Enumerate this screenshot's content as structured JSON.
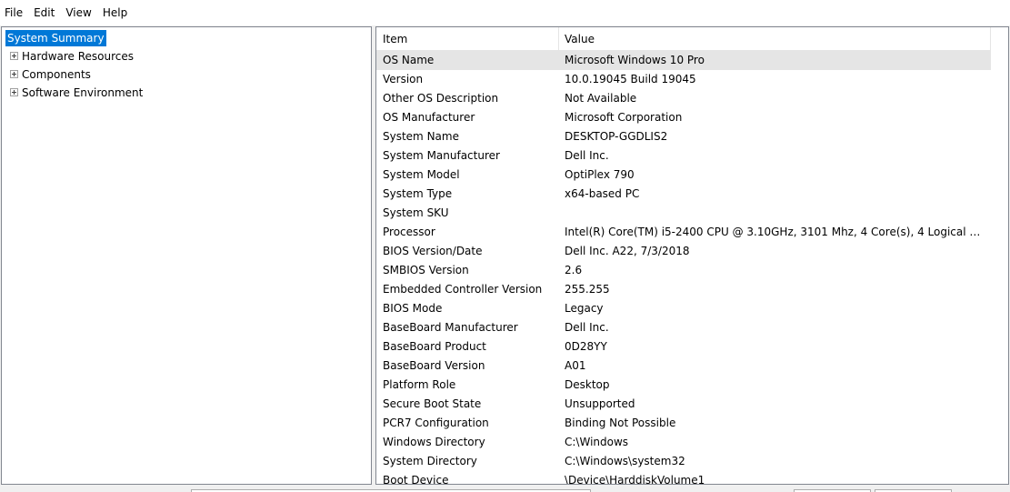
{
  "menu": {
    "file": "File",
    "edit": "Edit",
    "view": "View",
    "help": "Help"
  },
  "tree": {
    "root": "System Summary",
    "children": [
      {
        "label": "Hardware Resources"
      },
      {
        "label": "Components"
      },
      {
        "label": "Software Environment"
      }
    ]
  },
  "list": {
    "headers": {
      "item": "Item",
      "value": "Value"
    },
    "rows": [
      {
        "item": "OS Name",
        "value": "Microsoft Windows 10 Pro"
      },
      {
        "item": "Version",
        "value": "10.0.19045 Build 19045"
      },
      {
        "item": "Other OS Description",
        "value": "Not Available"
      },
      {
        "item": "OS Manufacturer",
        "value": "Microsoft Corporation"
      },
      {
        "item": "System Name",
        "value": "DESKTOP-GGDLIS2"
      },
      {
        "item": "System Manufacturer",
        "value": "Dell Inc."
      },
      {
        "item": "System Model",
        "value": "OptiPlex 790"
      },
      {
        "item": "System Type",
        "value": "x64-based PC"
      },
      {
        "item": "System SKU",
        "value": ""
      },
      {
        "item": "Processor",
        "value": "Intel(R) Core(TM) i5-2400 CPU @ 3.10GHz, 3101 Mhz, 4 Core(s), 4 Logical Pro..."
      },
      {
        "item": "BIOS Version/Date",
        "value": "Dell Inc. A22, 7/3/2018"
      },
      {
        "item": "SMBIOS Version",
        "value": "2.6"
      },
      {
        "item": "Embedded Controller Version",
        "value": "255.255"
      },
      {
        "item": "BIOS Mode",
        "value": "Legacy"
      },
      {
        "item": "BaseBoard Manufacturer",
        "value": "Dell Inc."
      },
      {
        "item": "BaseBoard Product",
        "value": "0D28YY"
      },
      {
        "item": "BaseBoard Version",
        "value": "A01"
      },
      {
        "item": "Platform Role",
        "value": "Desktop"
      },
      {
        "item": "Secure Boot State",
        "value": "Unsupported"
      },
      {
        "item": "PCR7 Configuration",
        "value": "Binding Not Possible"
      },
      {
        "item": "Windows Directory",
        "value": "C:\\Windows"
      },
      {
        "item": "System Directory",
        "value": "C:\\Windows\\system32"
      },
      {
        "item": "Boot Device",
        "value": "\\Device\\HarddiskVolume1"
      }
    ]
  },
  "colors": {
    "selection": "#0078d7",
    "row_highlight": "#e5e5e5",
    "border": "#828790"
  }
}
